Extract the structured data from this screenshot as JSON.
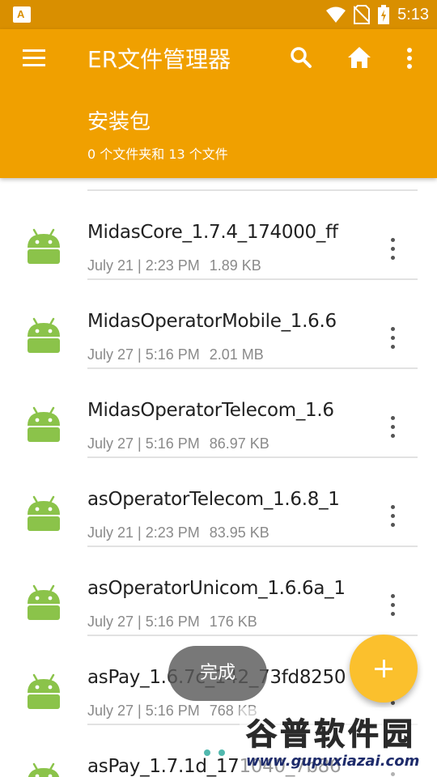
{
  "status_bar": {
    "time": "5:13",
    "icons": [
      "app-notification-icon",
      "wifi-icon",
      "no-sim-icon",
      "battery-charging-icon"
    ]
  },
  "app_bar": {
    "title": "ER文件管理器",
    "menu_icon": "hamburger-menu-icon",
    "actions": [
      "search-icon",
      "home-icon",
      "overflow-menu-icon"
    ],
    "background_color": "#f0a000"
  },
  "folder": {
    "name": "安装包",
    "summary": "0 个文件夹和 13 个文件"
  },
  "files": [
    {
      "name": "MidasCore_1.7.4_174000_ff",
      "date": "July 21 | 2:23 PM",
      "size": "1.89 KB",
      "icon": "android-apk-icon"
    },
    {
      "name": "MidasOperatorMobile_1.6.6",
      "date": "July 27 | 5:16 PM",
      "size": "2.01 MB",
      "icon": "android-apk-icon"
    },
    {
      "name": "MidasOperatorTelecom_1.6",
      "date": "July 27 | 5:16 PM",
      "size": "86.97 KB",
      "icon": "android-apk-icon"
    },
    {
      "name": "asOperatorTelecom_1.6.8_1",
      "date": "July 21 | 2:23 PM",
      "size": "83.95 KB",
      "icon": "android-apk-icon"
    },
    {
      "name": "asOperatorUnicom_1.6.6a_1",
      "date": "July 27 | 5:16 PM",
      "size": "176 KB",
      "icon": "android-apk-icon"
    },
    {
      "name": "asPay_1.6.7c_142_73fd8250",
      "date": "July 27 | 5:16 PM",
      "size": "768 KB",
      "icon": "android-apk-icon"
    },
    {
      "name": "asPay_1.7.1d_171040_7b86",
      "date": "",
      "size": "",
      "icon": "android-apk-icon"
    }
  ],
  "toast": {
    "text": "完成"
  },
  "fab": {
    "icon": "plus-icon",
    "color": "#fbc02d"
  },
  "watermark": {
    "text": "谷普软件园",
    "url": "www.gupuxiazai.com"
  }
}
